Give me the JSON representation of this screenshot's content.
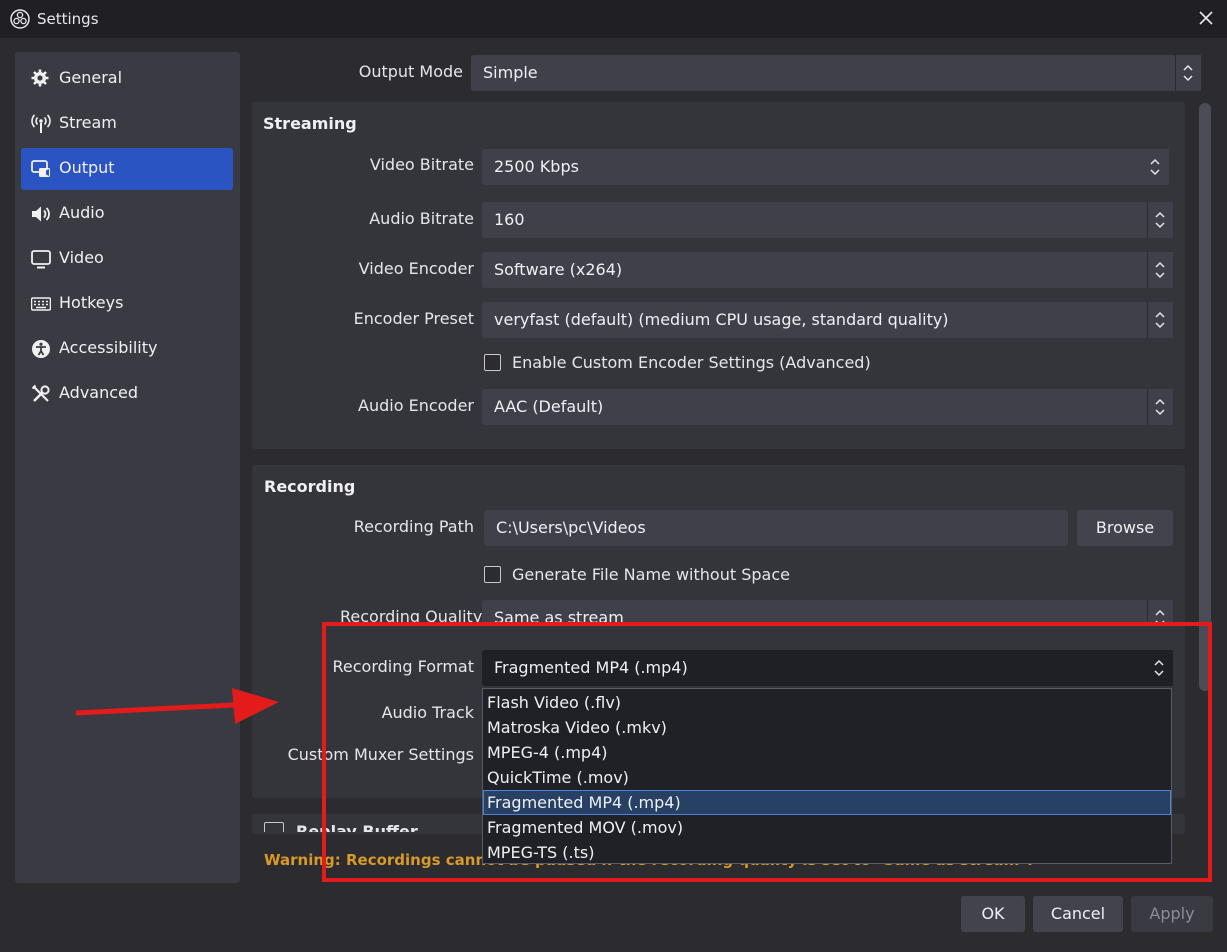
{
  "window": {
    "title": "Settings"
  },
  "sidebar": {
    "items": [
      {
        "label": "General",
        "icon": "gear-icon"
      },
      {
        "label": "Stream",
        "icon": "antenna-icon"
      },
      {
        "label": "Output",
        "icon": "output-icon",
        "active": true
      },
      {
        "label": "Audio",
        "icon": "speaker-icon"
      },
      {
        "label": "Video",
        "icon": "monitor-icon"
      },
      {
        "label": "Hotkeys",
        "icon": "keyboard-icon"
      },
      {
        "label": "Accessibility",
        "icon": "accessibility-icon"
      },
      {
        "label": "Advanced",
        "icon": "tools-icon"
      }
    ]
  },
  "output_mode": {
    "label": "Output Mode",
    "value": "Simple"
  },
  "streaming": {
    "title": "Streaming",
    "video_bitrate": {
      "label": "Video Bitrate",
      "value": "2500 Kbps"
    },
    "audio_bitrate": {
      "label": "Audio Bitrate",
      "value": "160"
    },
    "video_encoder": {
      "label": "Video Encoder",
      "value": "Software (x264)"
    },
    "encoder_preset": {
      "label": "Encoder Preset",
      "value": "veryfast (default) (medium CPU usage, standard quality)"
    },
    "custom_encoder": {
      "label": "Enable Custom Encoder Settings (Advanced)",
      "checked": false
    },
    "audio_encoder": {
      "label": "Audio Encoder",
      "value": "AAC (Default)"
    }
  },
  "recording": {
    "title": "Recording",
    "path": {
      "label": "Recording Path",
      "value": "C:\\Users\\pc\\Videos",
      "browse": "Browse"
    },
    "no_space": {
      "label": "Generate File Name without Space",
      "checked": false
    },
    "quality": {
      "label": "Recording Quality",
      "value": "Same as stream"
    },
    "format": {
      "label": "Recording Format",
      "value": "Fragmented MP4 (.mp4)",
      "options": [
        "Flash Video (.flv)",
        "Matroska Video (.mkv)",
        "MPEG-4 (.mp4)",
        "QuickTime (.mov)",
        "Fragmented MP4 (.mp4)",
        "Fragmented MOV (.mov)",
        "MPEG-TS (.ts)"
      ],
      "selected_index": 4
    },
    "audio_track": {
      "label": "Audio Track"
    },
    "muxer": {
      "label": "Custom Muxer Settings"
    }
  },
  "replay_buffer": {
    "label": "Replay Buffer"
  },
  "warning": "Warning: Recordings cannot be paused if the recording quality is set to \"Same as stream\".",
  "buttons": {
    "ok": "OK",
    "cancel": "Cancel",
    "apply": "Apply"
  },
  "colors": {
    "accent": "#2a54c2",
    "warning": "#d79a2a",
    "annotation": "#e41b1b"
  }
}
